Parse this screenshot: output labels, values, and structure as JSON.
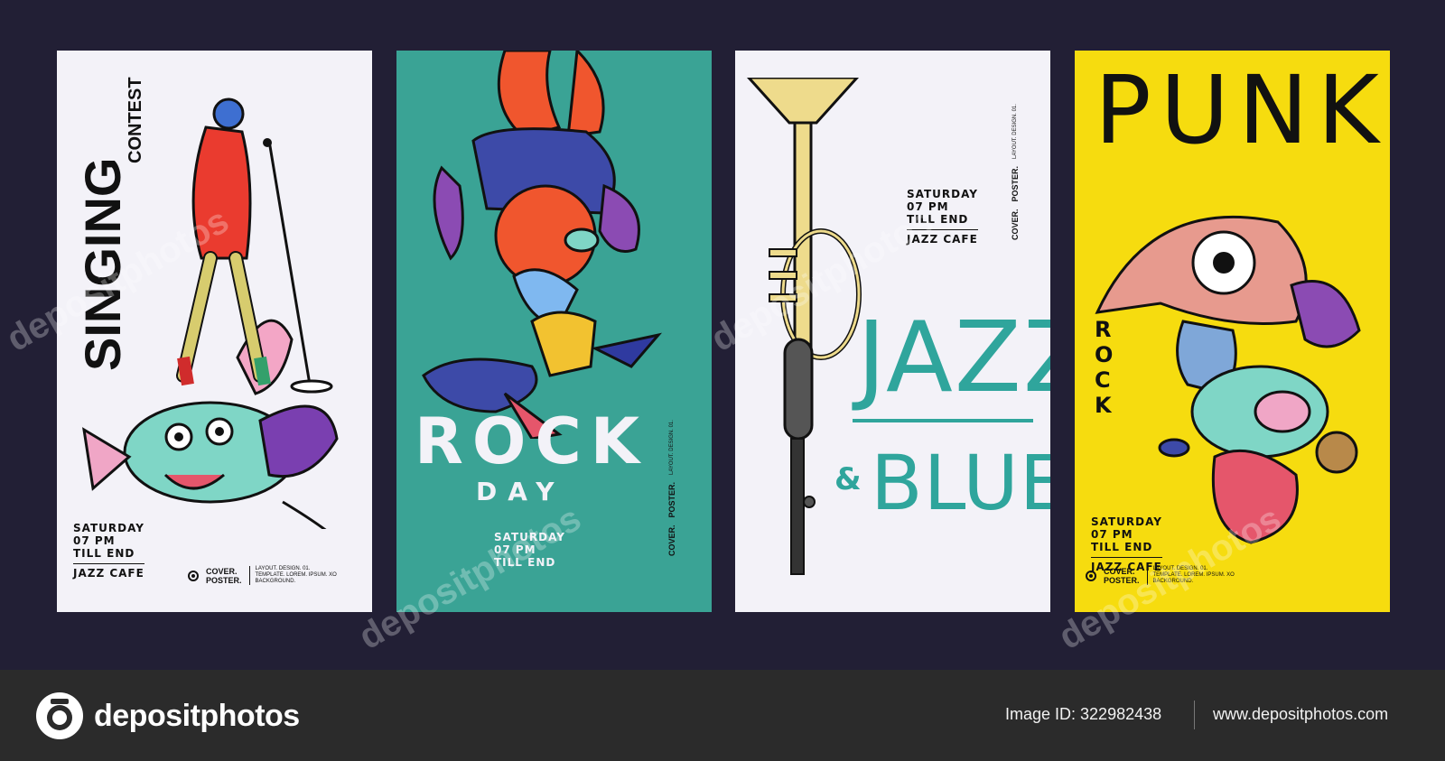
{
  "posters": [
    {
      "title": "SINGING",
      "subtitle": "CONTEST",
      "event_lines": [
        "SATURDAY",
        "07 PM",
        "TILL END",
        "JAZZ CAFE"
      ]
    },
    {
      "title": "ROCK",
      "title2": "DAY",
      "event_lines": [
        "SATURDAY",
        "07 PM",
        "TILL END"
      ]
    },
    {
      "title": "JAZZ",
      "amp": "&",
      "title2": "BLUES",
      "event_lines": [
        "SATURDAY",
        "07 PM",
        "TILL END",
        "JAZZ CAFE"
      ]
    },
    {
      "title": "PUNK",
      "subtitle": "ROCK",
      "event_lines": [
        "SATURDAY",
        "07 PM",
        "TILL END",
        "JAZZ CAFE"
      ]
    }
  ],
  "cover": {
    "label_line1": "COVER.",
    "label_line2": "POSTER.",
    "meta_line1": "LAYOUT. DESIGN. 01.",
    "meta_line2": "TEMPLATE. LOREM. IPSUM. XO",
    "meta_line3": "BACKGROUND."
  },
  "footer": {
    "brand": "depositphotos",
    "image_id": "Image ID: 322982438",
    "site": "www.depositphotos.com"
  },
  "watermark": "depositphotos",
  "colors": {
    "background": "#221f35",
    "teal": "#3aa395",
    "yellow": "#f6dc0f",
    "paper": "#f3f2f8",
    "footer": "#2b2b2b"
  }
}
